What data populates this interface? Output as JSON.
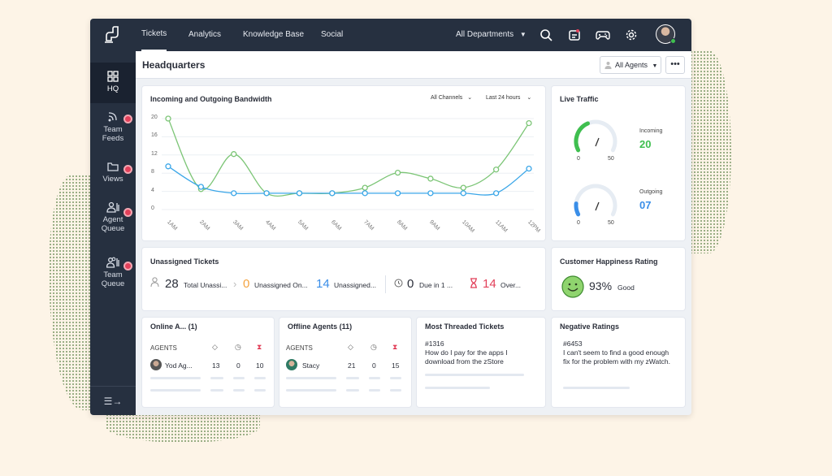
{
  "nav": {
    "tabs": [
      "Tickets",
      "Analytics",
      "Knowledge Base",
      "Social"
    ],
    "department": "All Departments"
  },
  "sidebar": {
    "items": [
      {
        "label": "HQ"
      },
      {
        "label": "Team Feeds"
      },
      {
        "label": "Views"
      },
      {
        "label": "Agent Queue"
      },
      {
        "label": "Team Queue"
      }
    ]
  },
  "header": {
    "title": "Headquarters",
    "agents_filter": "All Agents",
    "more": "•••"
  },
  "bandwidth": {
    "title": "Incoming and Outgoing Bandwidth",
    "channel_filter": "All Channels",
    "time_filter": "Last 24 hours"
  },
  "chart_data": {
    "type": "line",
    "categories": [
      "1AM",
      "2AM",
      "3AM",
      "4AM",
      "5AM",
      "6AM",
      "7AM",
      "8AM",
      "9AM",
      "10AM",
      "11AM",
      "12PM"
    ],
    "yticks": [
      0,
      4,
      8,
      12,
      16,
      20
    ],
    "ylim": [
      0,
      20
    ],
    "series": [
      {
        "color": "#7cc576",
        "values": [
          20,
          4.5,
          12.2,
          3.6,
          3.6,
          3.6,
          4.8,
          8.1,
          6.8,
          4.8,
          8.8,
          19
        ]
      },
      {
        "color": "#3aa6e8",
        "values": [
          9.5,
          5,
          3.6,
          3.6,
          3.6,
          3.6,
          3.6,
          3.6,
          3.6,
          3.6,
          3.6,
          9
        ]
      }
    ],
    "grid": true
  },
  "live_traffic": {
    "title": "Live Traffic",
    "incoming_label": "Incoming",
    "incoming_value": "20",
    "outgoing_label": "Outgoing",
    "outgoing_value": "07",
    "gauge_min": "0",
    "gauge_max": "50",
    "incoming_fraction": 0.4,
    "outgoing_fraction": 0.14,
    "incoming_color": "#3fbf4f",
    "outgoing_color": "#3a8ee8"
  },
  "unassigned": {
    "title": "Unassigned Tickets",
    "total_value": "28",
    "total_label": "Total Unassi...",
    "online_value": "0",
    "online_label": "Unassigned On...",
    "unassigned_value": "14",
    "unassigned_label": "Unassigned...",
    "due_value": "0",
    "due_label": "Due in 1 ...",
    "overdue_value": "14",
    "overdue_label": "Over..."
  },
  "happiness": {
    "title": "Customer Happiness Rating",
    "percent": "93%",
    "label": "Good"
  },
  "online_agents": {
    "title": "Online A... (1)",
    "header": "AGENTS",
    "row": {
      "name": "Yod Ag...",
      "open": "13",
      "due": "0",
      "overdue": "10"
    }
  },
  "offline_agents": {
    "title": "Offline Agents (11)",
    "header": "AGENTS",
    "row": {
      "name": "Stacy",
      "open": "21",
      "due": "0",
      "overdue": "15"
    }
  },
  "threaded": {
    "title": "Most Threaded Tickets",
    "ticket_id": "#1316",
    "ticket_text": "How do I pay for the apps I download from the zStore"
  },
  "negative": {
    "title": "Negative Ratings",
    "ticket_id": "#6453",
    "ticket_text": "I can't seem to find a good enough fix for the problem with my zWatch."
  },
  "colors": {
    "topbar": "#263040",
    "overdue": "#e2405a",
    "pending": "#f4a340",
    "blue": "#3a8ee8"
  }
}
